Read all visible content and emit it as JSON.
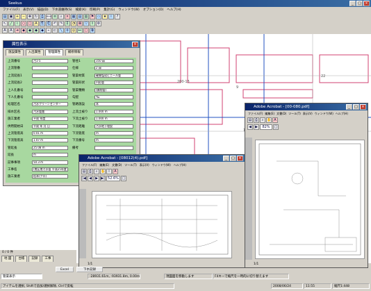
{
  "main": {
    "title": "Seekus",
    "menu": [
      "ファイル(F)",
      "表示(V)",
      "描画(D)",
      "下水道維持(S)",
      "検索(K)",
      "印刷(P)",
      "集計(G)",
      "ウィンドウ(W)",
      "オプション(O)",
      "ヘルプ(H)"
    ],
    "map_labels": [
      "200-13",
      "22",
      "9",
      "11"
    ]
  },
  "attr_panel": {
    "title": "属性表示",
    "tabs": [
      "施設属性",
      "入出属性",
      "管理属性",
      "補修情報"
    ],
    "rows": [
      {
        "l": "上流番号",
        "v": "汚1-5",
        "l2": "管径1",
        "v2": "350 ㎜"
      },
      {
        "l": "上流管番",
        "v": "",
        "l2": "仕様",
        "v2": "2 ㎜"
      },
      {
        "l": "上流延長1",
        "v": "",
        "l2": "管渠材質",
        "v2": "硬質塩化ビニール管"
      },
      {
        "l": "上流延長2",
        "v": "",
        "l2": "管渠形状",
        "v2": "円形管"
      },
      {
        "l": "上人孔番号",
        "v": "",
        "l2": "管渠種類",
        "v2": "(開削管)"
      },
      {
        "l": "下人孔番号",
        "v": "",
        "l2": "勾配",
        "v2": "‰"
      },
      {
        "l": "処理区名",
        "v": "汚水クリーンセンター",
        "l2": "管路施設",
        "v2": "本"
      },
      {
        "l": "排水区名",
        "v": "汚水管路",
        "l2": "上流土被り",
        "v2": "1.000 m"
      },
      {
        "l": "施工業者",
        "v": "平成 年度",
        "l2": "下流土被り",
        "v2": "1.000 m"
      },
      {
        "l": "供用開始日",
        "v": "平成 年 月 日",
        "l2": "下流距離",
        "v2": "汚水地下埋設"
      },
      {
        "l": "上流管底高",
        "v": "0.01 m",
        "l2": "下流管底",
        "v2": "m"
      },
      {
        "l": "下流管底高",
        "v": "1.07 m",
        "l2": "下流番号",
        "v2": "m"
      },
      {
        "l": "管延長",
        "v": "25.08 m",
        "l2": "備考",
        "v2": ""
      },
      {
        "l": "延長",
        "v": "m",
        "l2": "",
        "v2": ""
      },
      {
        "l": "記事事項",
        "v": "50.3 m",
        "l2": "",
        "v2": ""
      },
      {
        "l": "工事名",
        "v": "(南区南汚水管 平成25年度 汚水管工事)",
        "l2": "",
        "v2": ""
      },
      {
        "l": "施工業者",
        "v": "松本(クロ)",
        "l2": "",
        "v2": ""
      }
    ]
  },
  "pdf1": {
    "title": "Adobe Acrobat - [08012(4).pdf]",
    "menu": [
      "ファイル(F)",
      "編集(E)",
      "文書(D)",
      "ツール(T)",
      "表示(V)",
      "ウィンドウ(W)",
      "ヘルプ(H)"
    ],
    "zoom": "52.6%",
    "page": "1/1"
  },
  "pdf2": {
    "title": "Adobe Acrobat - [00-080.pdf]",
    "menu": [
      "ファイル(F)",
      "編集(E)",
      "文書(D)",
      "ツール(T)",
      "表示(V)",
      "ウィンドウ(W)",
      "ヘルプ(H)"
    ],
    "zoom": "82%",
    "page": "1/1"
  },
  "bottom": {
    "count": "0 / 0 件",
    "tabs": [
      "地 図",
      "台帳",
      "記録",
      "工事",
      "Excel",
      "下水記録"
    ],
    "layer": "管渠表示",
    "coords": "-28931.61m, -93931.8m, 0.00m",
    "hint": "現図面を移動します",
    "hint2": "F4キーで縮尺を一時的に切り替えます",
    "status_left": "アイテムを選択, Shiftで追加/選択解除, Ctrlで反転",
    "date": "2008/06/24",
    "time": "11:55",
    "scale": "縮尺1:448"
  }
}
